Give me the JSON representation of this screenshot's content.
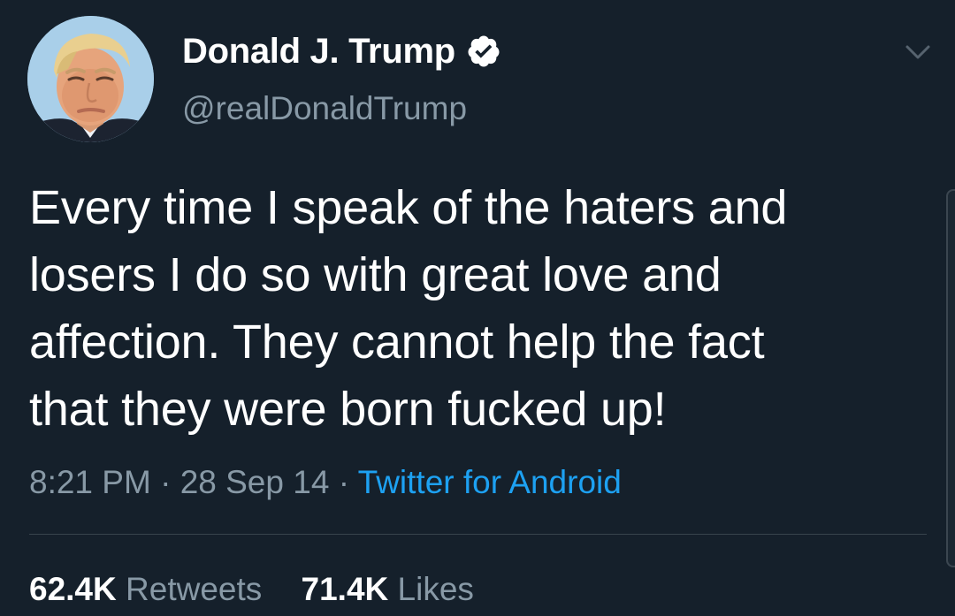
{
  "user": {
    "display_name": "Donald J. Trump",
    "handle": "@realDonaldTrump",
    "verified": true
  },
  "tweet": {
    "lines": [
      "Every time I speak of the haters and",
      "losers I do so with great love and",
      "affection. They cannot help the fact",
      "that they were born fucked up!"
    ]
  },
  "meta": {
    "time": "8:21 PM",
    "separator": "·",
    "date": "28 Sep 14",
    "source": "Twitter for Android"
  },
  "stats": {
    "retweets_count": "62.4K",
    "retweets_label": "Retweets",
    "likes_count": "71.4K",
    "likes_label": "Likes"
  },
  "icons": {
    "verified": "verified-badge-icon",
    "caret": "chevron-down-icon"
  },
  "colors": {
    "background": "#15202b",
    "primary_text": "#ffffff",
    "secondary_text": "#8899a6",
    "link": "#1da1f2",
    "divider": "#38444d"
  }
}
